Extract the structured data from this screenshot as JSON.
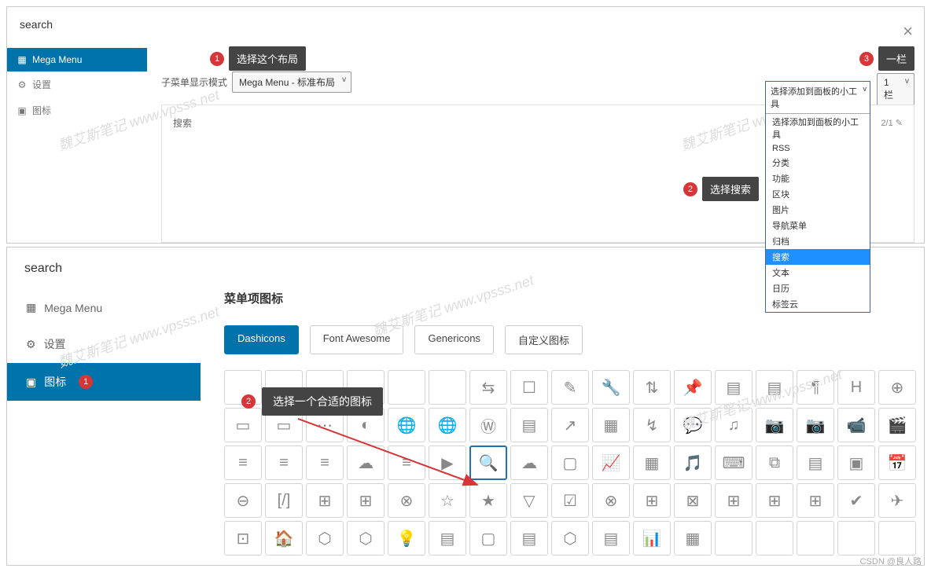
{
  "top": {
    "title": "search",
    "sidebar": [
      {
        "label": "Mega Menu"
      },
      {
        "label": "设置"
      },
      {
        "label": "图标"
      }
    ],
    "sub_mode_label": "子菜单显示模式",
    "sub_mode_value": "Mega Menu - 标准布局",
    "callout1": {
      "num": "1",
      "text": "选择这个布局"
    },
    "callout2": {
      "num": "2",
      "text": "选择搜索"
    },
    "callout3": {
      "num": "3",
      "text": "一栏"
    },
    "col_select": "1 栏",
    "widget_name": "搜索",
    "widget_page": "2/1",
    "dropdown": {
      "selected": "选择添加到面板的小工具",
      "items": [
        "选择添加到面板的小工具",
        "RSS",
        "分类",
        "功能",
        "区块",
        "图片",
        "导航菜单",
        "归档",
        "搜索",
        "文本",
        "日历",
        "标签云"
      ],
      "highlight": "搜索"
    }
  },
  "bottom": {
    "title": "search",
    "sidebar": [
      {
        "label": "Mega Menu"
      },
      {
        "label": "设置"
      },
      {
        "label": "图标",
        "badge": "1"
      }
    ],
    "section_title": "菜单项图标",
    "tabs": [
      "Dashicons",
      "Font Awesome",
      "Genericons",
      "自定义图标"
    ],
    "tooltip": {
      "num": "2",
      "text": "选择一个合适的图标"
    }
  },
  "watermark": "魏艾斯笔记 www.vpsss.net",
  "credit": "CSDN @良人路"
}
